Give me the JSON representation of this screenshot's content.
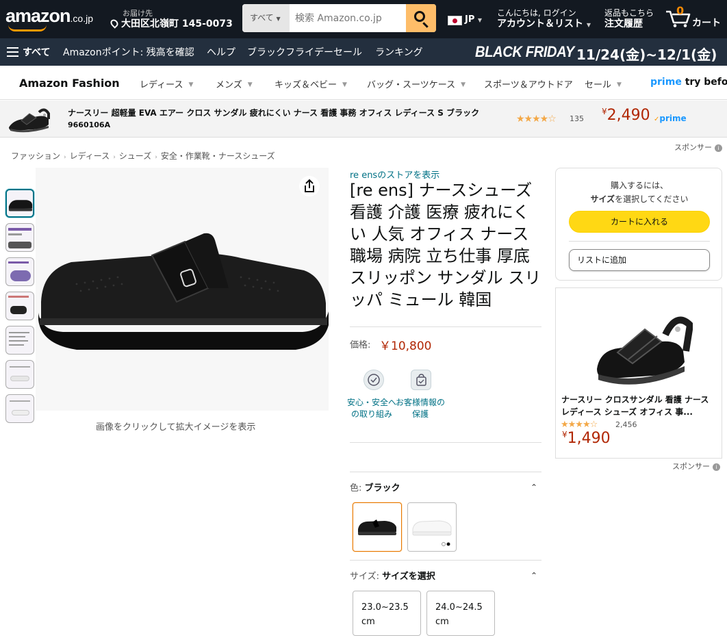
{
  "header": {
    "logo": "amazon",
    "logo_tld": ".co.jp",
    "deliver_to": "お届け先",
    "deliver_address": "大田区北嶺町 145-0073",
    "search_category": "すべて",
    "search_placeholder": "検索 Amazon.co.jp",
    "language": "JP",
    "account_top": "こんにちは, ログイン",
    "account_bottom": "アカウント＆リスト",
    "returns_top": "返品もこちら",
    "returns_bottom": "注文履歴",
    "cart_count": "0",
    "cart_label": "カート"
  },
  "subnav": {
    "all": "すべて",
    "items": [
      "Amazonポイント: 残高を確認",
      "ヘルプ",
      "ブラックフライデーセール",
      "ランキング"
    ],
    "promo_title": "BLACK FRIDAY",
    "promo_dates": "11/24(金)~12/1(金)"
  },
  "fashion_nav": {
    "title": "Amazon Fashion",
    "items": [
      "レディース",
      "メンズ",
      "キッズ＆ベビー",
      "バッグ・スーツケース",
      "スポーツ＆アウトドア",
      "セール"
    ],
    "prime_word": "prime",
    "prime_rest": "try before"
  },
  "sponsored_bar": {
    "title": "ナースリー 超軽量 EVA エアー クロス サンダル 疲れにくい ナース 看護 事務 オフィス レディース S ブラック",
    "sku": "9660106A",
    "rating": 4,
    "stars_text": "★★★★☆",
    "review_count": "135",
    "price_symbol": "¥",
    "price": "2,490",
    "prime_badge": "prime",
    "sponsored_label": "スポンサー"
  },
  "breadcrumb": [
    "ファッション",
    "レディース",
    "シューズ",
    "安全・作業靴・ナースシューズ"
  ],
  "gallery": {
    "thumbnail_count": 7,
    "caption": "画像をクリックして拡大イメージを表示"
  },
  "product": {
    "store_link": "re ensのストアを表示",
    "title": "[re ens] ナースシューズ 看護 介護 医療 疲れにくい 人気 オフィス ナース 職場 病院 立ち仕事 厚底 スリッポン サンダル スリッパ ミュール 韓国",
    "price_label": "価格:",
    "price": "￥10,800",
    "trust": [
      "安心・安全への取り組み",
      "お客様情報の保護"
    ],
    "color_label": "色:",
    "color_value": "ブラック",
    "size_label": "サイズ:",
    "size_value": "サイズを選択",
    "sizes": [
      "23.0~23.5 cm",
      "24.0~24.5 cm"
    ]
  },
  "buybox": {
    "message_line1": "購入するには、",
    "message_bold": "サイズ",
    "message_line2_rest": "を選択してください",
    "cart_button": "カートに入れる",
    "list_button": "リストに追加"
  },
  "ad_card": {
    "title": "ナースリー クロスサンダル 看護 ナース レディース シューズ オフィス 事...",
    "rating": 4,
    "stars_text": "★★★★☆",
    "review_count": "2,456",
    "price_symbol": "¥",
    "price": "1,490",
    "sponsored_label": "スポンサー"
  },
  "colors": {
    "nav_dark": "#131921",
    "nav_secondary": "#232f3e",
    "search_button": "#febd69",
    "cart_button": "#ffd814",
    "price_red": "#b12704",
    "link_teal": "#007185",
    "prime_blue": "#1a98ff",
    "selected_orange": "#e77600"
  },
  "icons": [
    "location-pin-icon",
    "search-icon",
    "cart-icon",
    "menu-icon",
    "share-icon",
    "chevron-down-icon",
    "chevron-up-icon",
    "info-icon",
    "shield-check-icon",
    "lock-bag-icon"
  ]
}
